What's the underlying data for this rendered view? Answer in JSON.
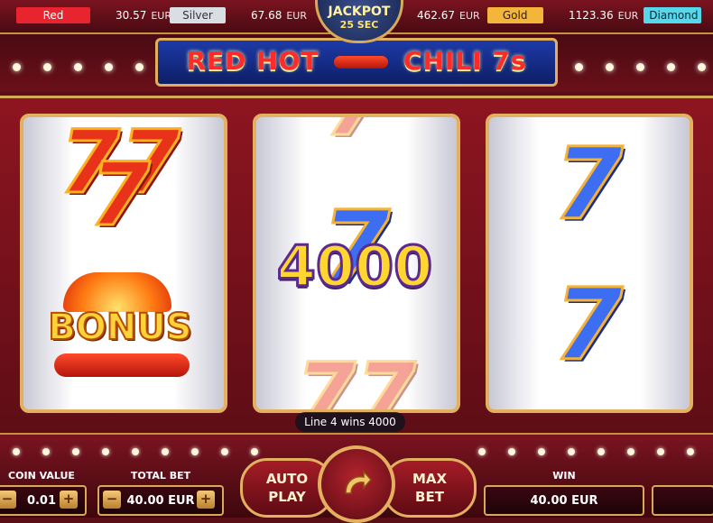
{
  "jackpots": [
    {
      "name": "Red",
      "value": "30.57",
      "currency": "EUR",
      "color": "#e8242e"
    },
    {
      "name": "Silver",
      "value": "67.68",
      "currency": "EUR",
      "color": "#d9dde4"
    },
    {
      "name": "Gold",
      "value": "462.67",
      "currency": "EUR",
      "color": "#f4b63a"
    },
    {
      "name": "Diamond",
      "value": "1123.36",
      "currency": "EUR",
      "color": "#55d8ec"
    }
  ],
  "jackpot_badge": {
    "title": "JACKPOT",
    "timer": "25 SEC"
  },
  "game_title": {
    "part1": "RED HOT",
    "part2": "CHILI 7s"
  },
  "reels": [
    {
      "symbols": [
        "fire-seven",
        "bonus"
      ]
    },
    {
      "symbols": [
        "blue-seven"
      ]
    },
    {
      "symbols": [
        "blue-seven",
        "blue-seven"
      ]
    }
  ],
  "bonus_label": "BONUS",
  "win_amount": "4000",
  "line_message": "Line 4 wins 4000",
  "coin_value": {
    "label": "COIN VALUE",
    "value": "0.01",
    "minus": "−",
    "plus": "+"
  },
  "total_bet": {
    "label": "TOTAL BET",
    "value": "40.00 EUR",
    "minus": "−",
    "plus": "+"
  },
  "buttons": {
    "auto_play": "AUTO PLAY",
    "max_bet": "MAX BET",
    "spin_icon": "spin-arrow-icon"
  },
  "win": {
    "label": "WIN",
    "value": "40.00 EUR"
  },
  "colors": {
    "accent_gold": "#e2b05e",
    "cabinet_red": "#8d1520",
    "win_text": "#ffd52f"
  }
}
